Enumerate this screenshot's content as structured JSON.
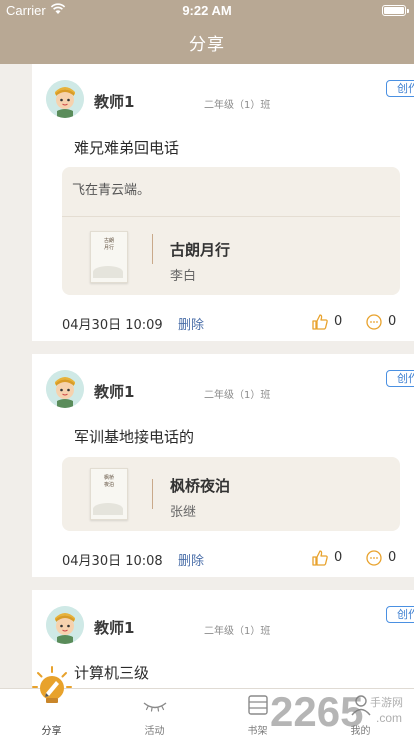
{
  "status_bar": {
    "carrier": "Carrier",
    "time": "9:22 AM"
  },
  "header": {
    "title": "分享"
  },
  "posts": [
    {
      "author": "教师1",
      "class_label": "二年级（1）班",
      "tag": "创作",
      "title": "难兄难弟回电话",
      "quote": "飞在青云端。",
      "book_title": "古朗月行",
      "book_author": "李白",
      "cover_text": "古朗月行",
      "date": "04月30日 10:09",
      "delete_label": "删除",
      "likes": "0",
      "comments": "0"
    },
    {
      "author": "教师1",
      "class_label": "二年级（1）班",
      "tag": "创作",
      "title": "军训基地接电话的",
      "book_title": "枫桥夜泊",
      "book_author": "张继",
      "cover_text": "枫桥夜泊",
      "date": "04月30日 10:08",
      "delete_label": "删除",
      "likes": "0",
      "comments": "0"
    },
    {
      "author": "教师1",
      "class_label": "二年级（1）班",
      "tag": "创作",
      "title": "计算机三级"
    }
  ],
  "tabs": [
    {
      "label": "分享",
      "icon": "lightbulb-pen-icon"
    },
    {
      "label": "活动",
      "icon": "eye-lash-icon"
    },
    {
      "label": "书架",
      "icon": "bookshelf-icon"
    },
    {
      "label": "我的",
      "icon": "person-icon"
    }
  ],
  "watermark": {
    "text": "2265",
    "sub1": "手游网",
    "sub2": ".com"
  },
  "colors": {
    "header": "#b8a894",
    "accent_blue": "#4a90e2",
    "quote_bg": "#f3efe8",
    "icon_gold": "#e8a22c"
  }
}
